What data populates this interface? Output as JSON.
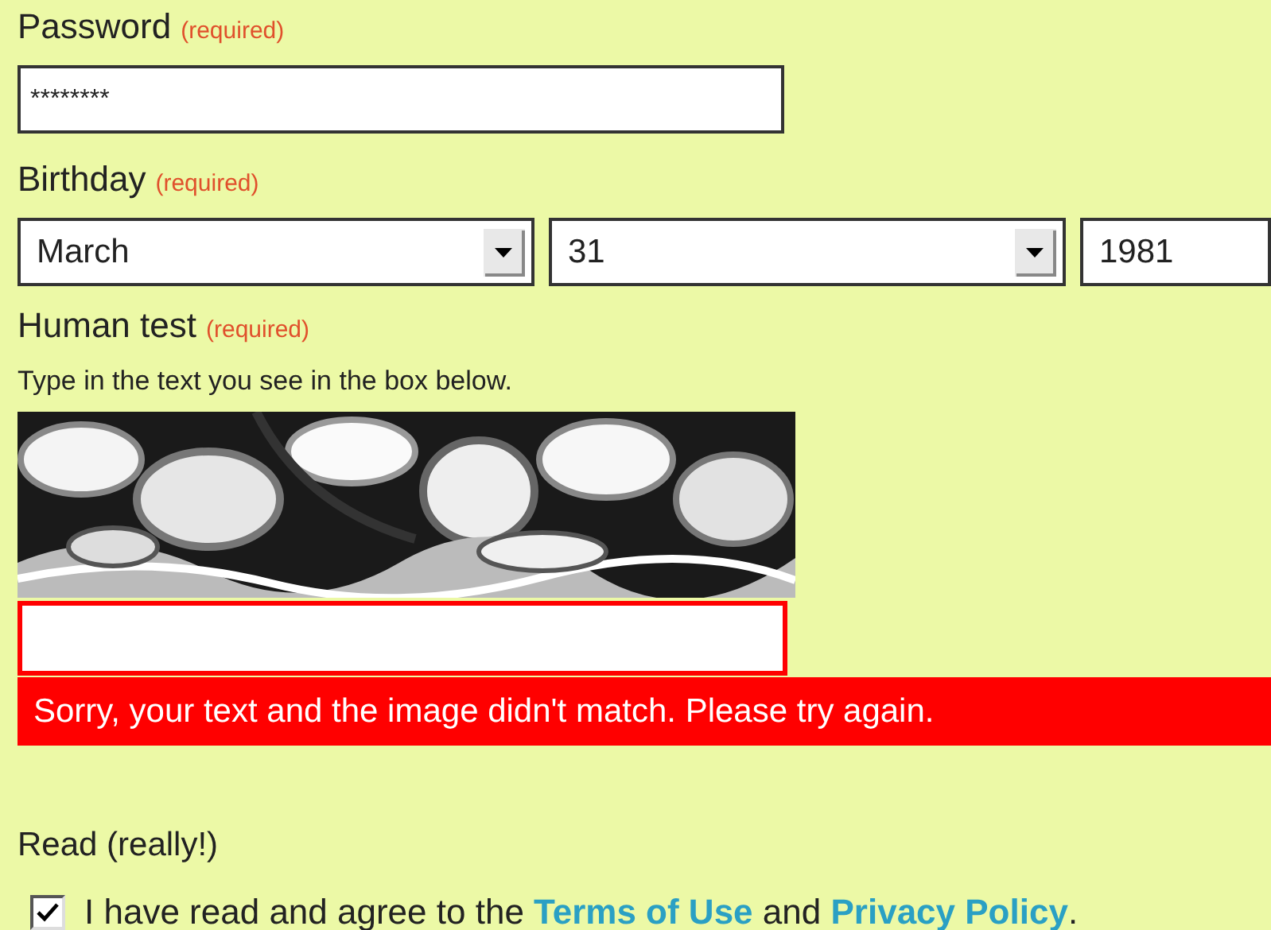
{
  "password": {
    "label": "Password",
    "note": "(required)",
    "value": "********"
  },
  "birthday": {
    "label": "Birthday",
    "note": "(required)",
    "selects": [
      {
        "kind": "dropdown",
        "value": "March"
      },
      {
        "kind": "dropdown",
        "value": "31"
      },
      {
        "kind": "clipped",
        "value": "1981"
      }
    ]
  },
  "human_test": {
    "label": "Human test",
    "note": "(required)",
    "instruction": "Type in the text you see in the box below.",
    "answer": {
      "error": true
    },
    "error_message": "Sorry, your text and the image didn't match. Please try again."
  },
  "read": {
    "label": "Read (really!)",
    "checked": true,
    "parts": [
      {
        "kind": "text",
        "text": "I have read and agree to the "
      },
      {
        "kind": "link",
        "text": "Terms of Use"
      },
      {
        "kind": "text",
        "text": " and "
      },
      {
        "kind": "link",
        "text": "Privacy Policy"
      },
      {
        "kind": "text",
        "text": "."
      }
    ]
  }
}
